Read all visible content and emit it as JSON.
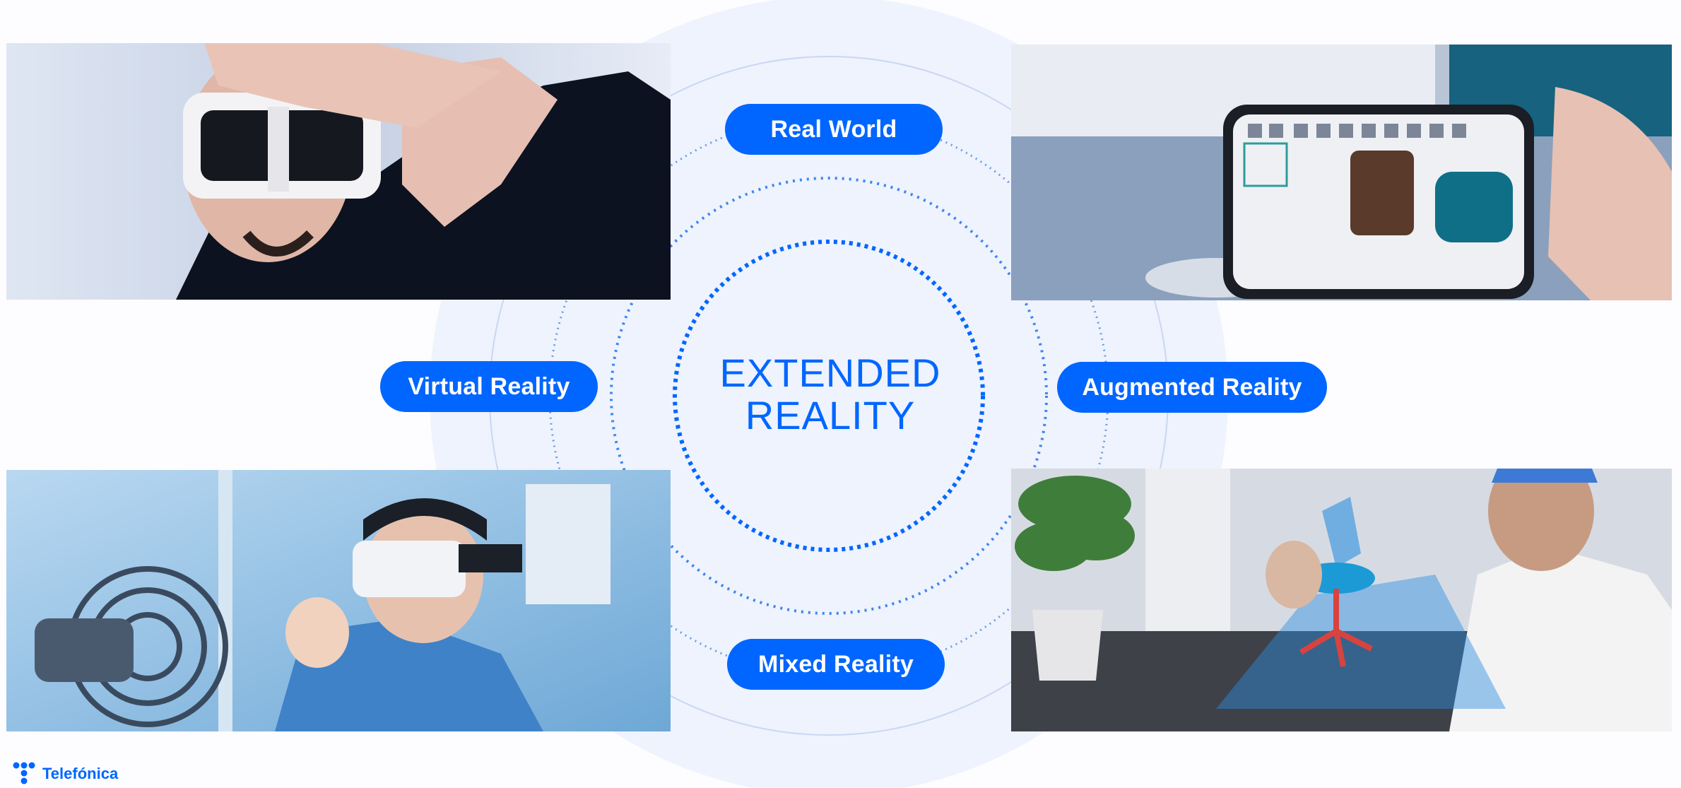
{
  "center": {
    "line1": "EXTENDED",
    "line2": "REALITY"
  },
  "labels": {
    "real_world": "Real World",
    "virtual_reality": "Virtual Reality",
    "augmented_reality": "Augmented Reality",
    "mixed_reality": "Mixed Reality"
  },
  "brand": {
    "name": "Telefónica"
  },
  "colors": {
    "accent": "#0066ff",
    "ring_fill": "#eef3fd",
    "ring_stroke": "#5b8fe6"
  },
  "images": [
    {
      "id": "vr-headset-man",
      "icon": "vr-headset-photo"
    },
    {
      "id": "ar-phone-furniture",
      "icon": "smartphone-ar-photo"
    },
    {
      "id": "vr-engineer-hologram",
      "icon": "hologram-engine-photo"
    },
    {
      "id": "mr-chair-hologram",
      "icon": "mixed-reality-chair-photo"
    }
  ]
}
